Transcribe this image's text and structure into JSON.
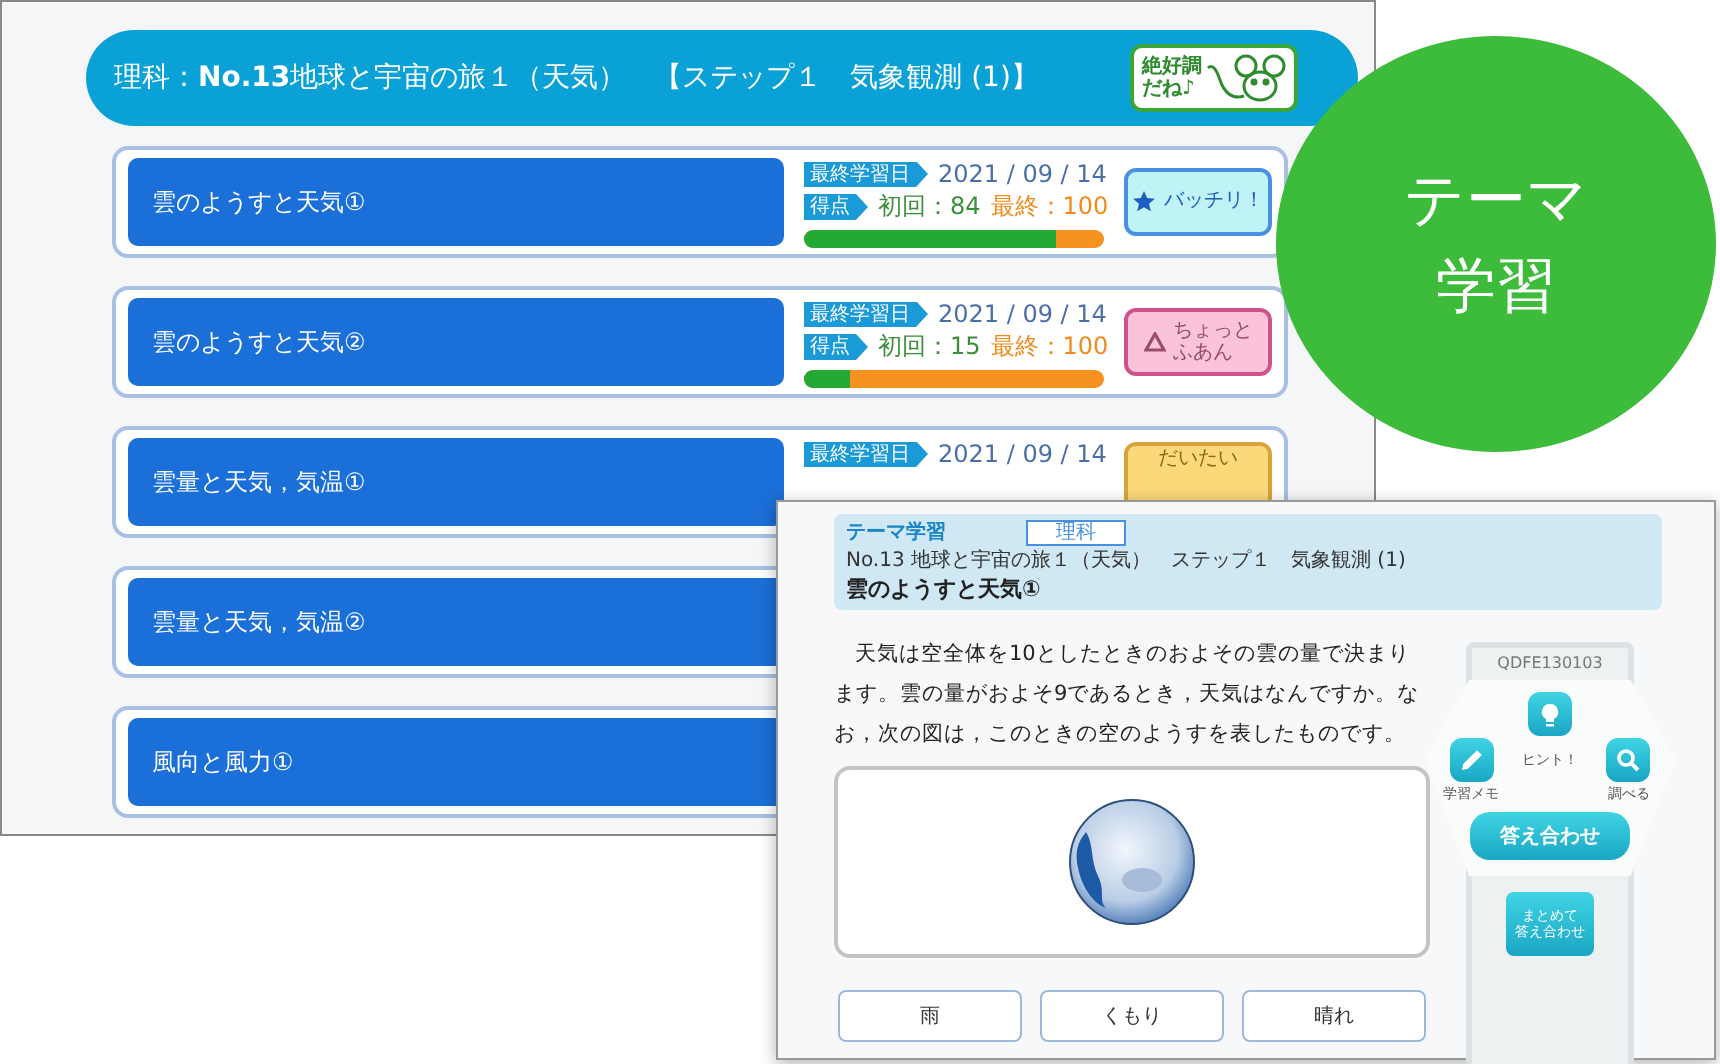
{
  "course_screen": {
    "header": {
      "title": "理科：**No.13**地球と宇宙の旅１（天気）　【ステップ１　気象観測 (1)】",
      "stamp": [
        "絶好調",
        "だね♪"
      ]
    },
    "lessons": [
      {
        "title": "雲のようすと天気①",
        "last_label": "最終学習日",
        "date": "2021 / 09 / 14",
        "score_label": "得点",
        "first": "初回：84",
        "final": "最終：100",
        "level": 0.84,
        "badge": {
          "kind": "great",
          "text": [
            "バッチリ！"
          ]
        }
      },
      {
        "title": "雲のようすと天気②",
        "last_label": "最終学習日",
        "date": "2021 / 09 / 14",
        "score_label": "得点",
        "first": "初回：15",
        "final": "最終：100",
        "level": 0.15,
        "badge": {
          "kind": "unsure",
          "text": [
            "ちょっと",
            "ふあん"
          ]
        }
      },
      {
        "title": "雲量と天気，気温①",
        "last_label": "最終学習日",
        "date": "2021 / 09 / 14",
        "badge": {
          "kind": "fair",
          "text": [
            "だいたい"
          ]
        }
      },
      {
        "title": "雲量と天気，気温②"
      },
      {
        "title": "風向と風力①"
      }
    ]
  },
  "theme_circle": {
    "line1": "テーマ",
    "line2": "学習"
  },
  "question_screen": {
    "header": {
      "mode": "テーマ学習",
      "subject": "理科",
      "course": "No.13 地球と宇宙の旅１（天気）　ステップ１　気象観測 (1)",
      "lesson": "雲のようすと天気①"
    },
    "question": "天気は空全体を10としたときのおよその雲の量で決まります。雲の量がおよそ9であるとき，天気はなんですか。なお，次の図は，このときの空のようすを表したものです。",
    "choices": [
      "雨",
      "くもり",
      "晴れ"
    ],
    "tools": {
      "code": "QDFE130103",
      "hint": "ヒント！",
      "memo": "学習メモ",
      "search": "調べる",
      "check": "答え合わせ",
      "check_all": [
        "まとめて",
        "答え合わせ"
      ]
    }
  }
}
